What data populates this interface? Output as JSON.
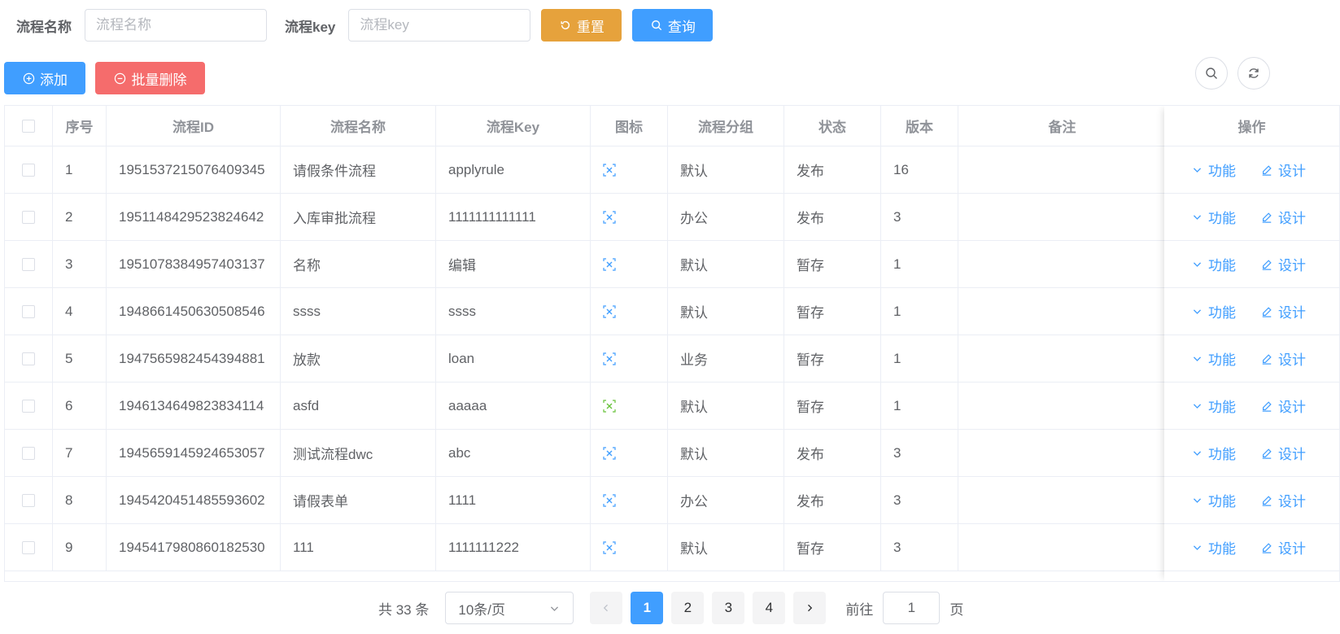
{
  "search": {
    "name_label": "流程名称",
    "name_placeholder": "流程名称",
    "key_label": "流程key",
    "key_placeholder": "流程key",
    "reset_label": "重置",
    "query_label": "查询"
  },
  "toolbar": {
    "add_label": "添加",
    "batch_delete_label": "批量删除"
  },
  "colors": {
    "primary": "#409eff",
    "warning": "#e6a23c",
    "danger": "#f56c6c",
    "icon_green": "#67c23a"
  },
  "table": {
    "columns": [
      "序号",
      "流程ID",
      "流程名称",
      "流程Key",
      "图标",
      "流程分组",
      "状态",
      "版本",
      "备注",
      "操作"
    ],
    "rows": [
      {
        "index": "1",
        "id": "1951537215076409345",
        "name": "请假条件流程",
        "key": "applyrule",
        "icon": "blue",
        "group": "默认",
        "status": "发布",
        "version": "16",
        "remark": ""
      },
      {
        "index": "2",
        "id": "1951148429523824642",
        "name": "入库审批流程",
        "key": "1111111111111",
        "icon": "blue",
        "group": "办公",
        "status": "发布",
        "version": "3",
        "remark": ""
      },
      {
        "index": "3",
        "id": "1951078384957403137",
        "name": "名称",
        "key": "编辑",
        "icon": "blue",
        "group": "默认",
        "status": "暂存",
        "version": "1",
        "remark": ""
      },
      {
        "index": "4",
        "id": "1948661450630508546",
        "name": "ssss",
        "key": "ssss",
        "icon": "blue",
        "group": "默认",
        "status": "暂存",
        "version": "1",
        "remark": ""
      },
      {
        "index": "5",
        "id": "1947565982454394881",
        "name": "放款",
        "key": "loan",
        "icon": "blue",
        "group": "业务",
        "status": "暂存",
        "version": "1",
        "remark": ""
      },
      {
        "index": "6",
        "id": "1946134649823834114",
        "name": "asfd",
        "key": "aaaaa",
        "icon": "green",
        "group": "默认",
        "status": "暂存",
        "version": "1",
        "remark": ""
      },
      {
        "index": "7",
        "id": "1945659145924653057",
        "name": "测试流程dwc",
        "key": "abc",
        "icon": "blue",
        "group": "默认",
        "status": "发布",
        "version": "3",
        "remark": ""
      },
      {
        "index": "8",
        "id": "1945420451485593602",
        "name": "请假表单",
        "key": "1111",
        "icon": "blue",
        "group": "办公",
        "status": "发布",
        "version": "3",
        "remark": ""
      },
      {
        "index": "9",
        "id": "1945417980860182530",
        "name": "111",
        "key": "1111111222",
        "icon": "blue",
        "group": "默认",
        "status": "暂存",
        "version": "3",
        "remark": ""
      }
    ],
    "action_function": "功能",
    "action_design": "设计"
  },
  "pagination": {
    "total_text": "共 33 条",
    "page_size": "10条/页",
    "pages": [
      "1",
      "2",
      "3",
      "4"
    ],
    "current": "1",
    "goto_label": "前往",
    "goto_value": "1",
    "page_suffix": "页"
  }
}
